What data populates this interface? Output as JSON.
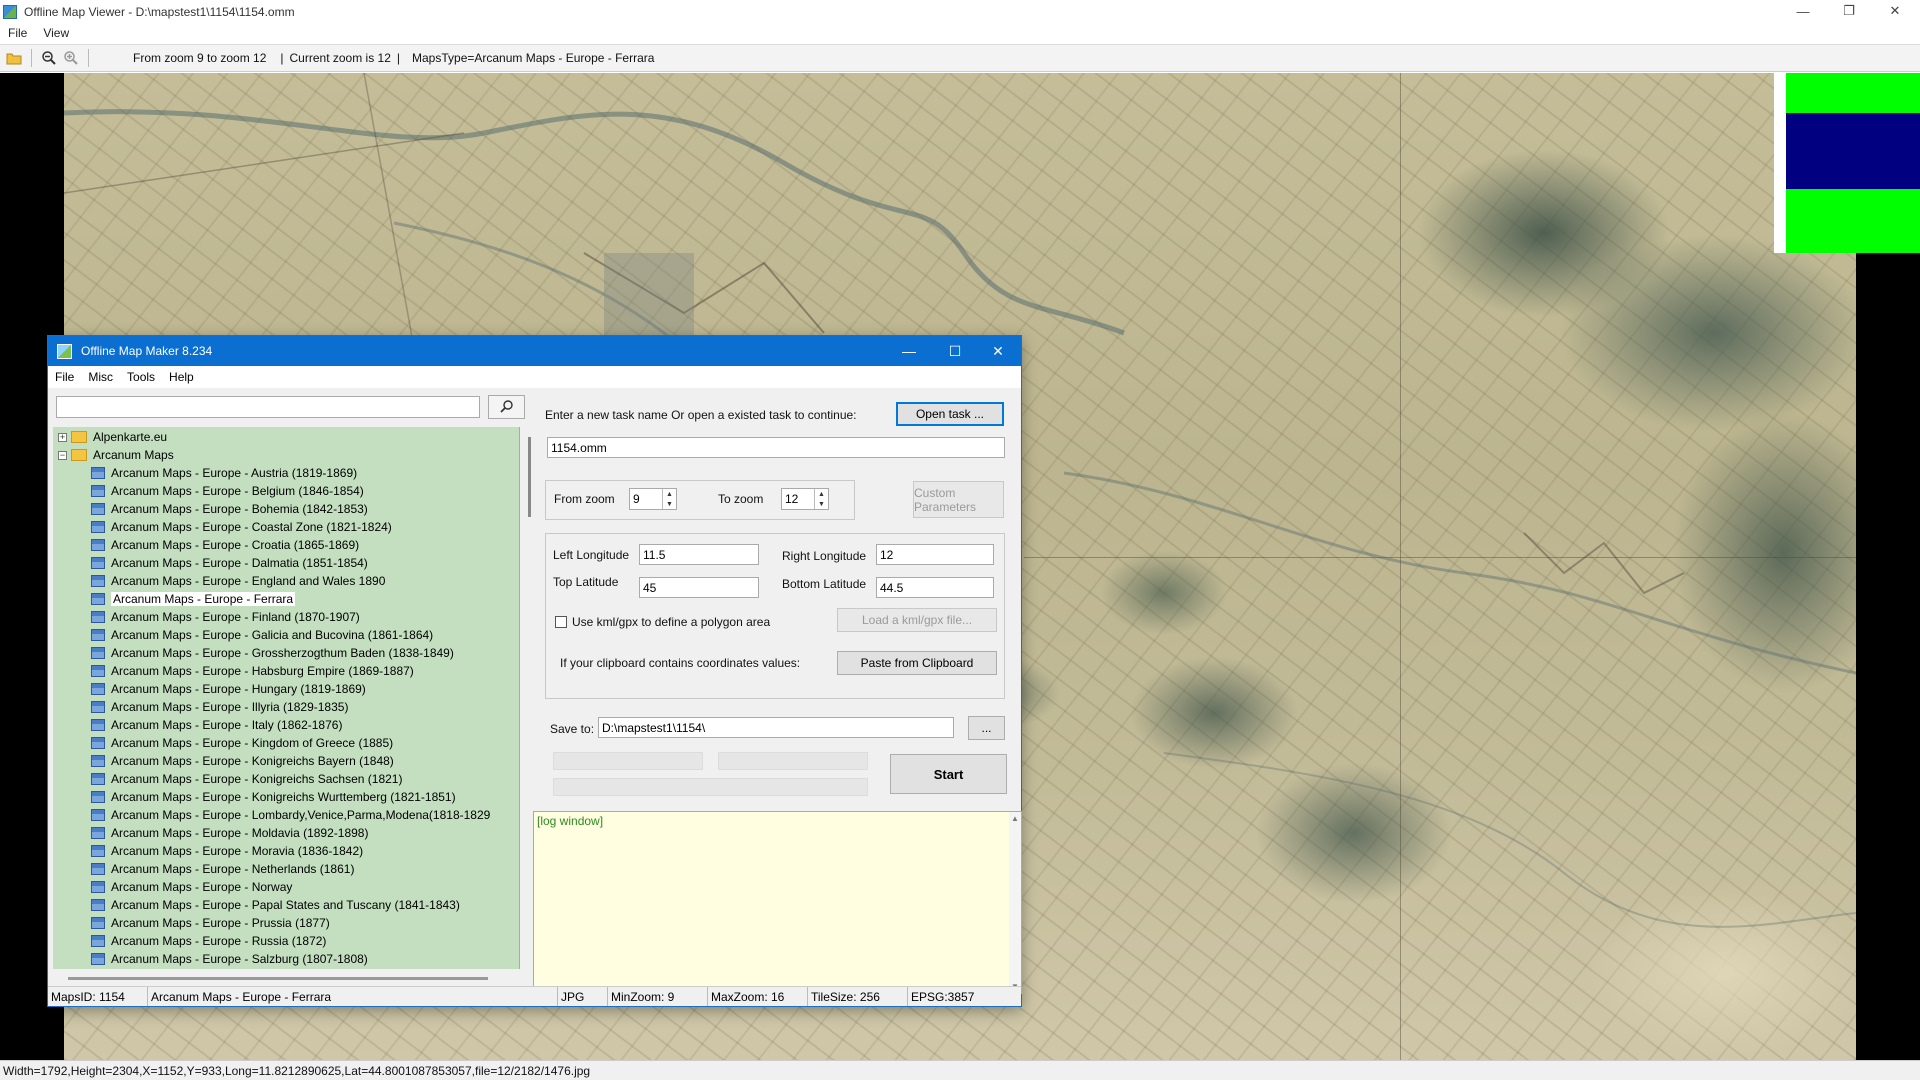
{
  "window": {
    "title": "Offline Map Viewer - D:\\mapstest1\\1154\\1154.omm"
  },
  "menu": [
    "File",
    "View"
  ],
  "toolbar": {
    "zoom_range": "From zoom 9 to zoom 12",
    "current_zoom": "Current zoom is 12",
    "maps_type": "MapsType=Arcanum Maps - Europe - Ferrara",
    "icons": [
      "open-folder-icon",
      "zoom-out-icon",
      "zoom-in-icon"
    ]
  },
  "colors": {
    "legend_top": "#00ff00",
    "legend_middle": "#000080",
    "legend_bottom": "#00ff00",
    "dialog_title": "#0a6fd1",
    "tree_bg": "#c3dfc0",
    "log_bg": "#fffee0"
  },
  "statusbar": {
    "text": "Width=1792,Height=2304,X=1152,Y=933,Long=11.8212890625,Lat=44.8001087853057,file=12/2182/1476.jpg"
  },
  "dialog": {
    "title": "Offline Map Maker 8.234",
    "menu": [
      "File",
      "Misc",
      "Tools",
      "Help"
    ],
    "search": {
      "value": "",
      "placeholder": ""
    },
    "tree": {
      "folders": [
        {
          "label": "Alpenkarte.eu",
          "expanded": false
        },
        {
          "label": "Arcanum Maps",
          "expanded": true
        }
      ],
      "items": [
        "Arcanum Maps - Europe - Austria (1819-1869)",
        "Arcanum Maps - Europe - Belgium (1846-1854)",
        "Arcanum Maps - Europe - Bohemia (1842-1853)",
        "Arcanum Maps - Europe - Coastal Zone (1821-1824)",
        "Arcanum Maps - Europe - Croatia (1865-1869)",
        "Arcanum Maps - Europe - Dalmatia (1851-1854)",
        "Arcanum Maps - Europe - England and Wales 1890",
        "Arcanum Maps - Europe - Ferrara",
        "Arcanum Maps - Europe - Finland (1870-1907)",
        "Arcanum Maps - Europe - Galicia and Bucovina (1861-1864)",
        "Arcanum Maps - Europe - Grossherzogthum Baden (1838-1849)",
        "Arcanum Maps - Europe - Habsburg Empire (1869-1887)",
        "Arcanum Maps - Europe - Hungary (1819-1869)",
        "Arcanum Maps - Europe - Illyria (1829-1835)",
        "Arcanum Maps - Europe - Italy (1862-1876)",
        "Arcanum Maps - Europe - Kingdom of Greece (1885)",
        "Arcanum Maps - Europe - Konigreichs Bayern (1848)",
        "Arcanum Maps - Europe - Konigreichs Sachsen (1821)",
        "Arcanum Maps - Europe - Konigreichs Wurttemberg (1821-1851)",
        "Arcanum Maps - Europe - Lombardy,Venice,Parma,Modena(1818-1829",
        "Arcanum Maps - Europe - Moldavia (1892-1898)",
        "Arcanum Maps - Europe - Moravia (1836-1842)",
        "Arcanum Maps - Europe - Netherlands (1861)",
        "Arcanum Maps - Europe - Norway",
        "Arcanum Maps - Europe - Papal States and Tuscany (1841-1843)",
        "Arcanum Maps - Europe - Prussia (1877)",
        "Arcanum Maps - Europe - Russia (1872)",
        "Arcanum Maps - Europe - Salzburg (1807-1808)"
      ],
      "selected": "Arcanum Maps - Europe - Ferrara"
    },
    "task_prompt": "Enter a new task name Or open a existed task to continue:",
    "open_task_label": "Open task ...",
    "task_name": "1154.omm",
    "from_zoom_label": "From zoom",
    "from_zoom_value": "9",
    "to_zoom_label": "To zoom",
    "to_zoom_value": "12",
    "custom_params_label": "Custom Parameters",
    "left_lon_label": "Left Longitude",
    "left_lon_value": "11.5",
    "right_lon_label": "Right Longitude",
    "right_lon_value": "12",
    "top_lat_label": "Top Latitude",
    "top_lat_value": "45",
    "bottom_lat_label": "Bottom Latitude",
    "bottom_lat_value": "44.5",
    "kml_checkbox_label": "Use kml/gpx to define a polygon area",
    "kml_checked": false,
    "load_kml_label": "Load a kml/gpx file...",
    "clipboard_prompt": "If your clipboard contains coordinates values:",
    "paste_label": "Paste from Clipboard",
    "save_to_label": "Save to:",
    "save_to_value": "D:\\mapstest1\\1154\\",
    "browse_label": "...",
    "start_label": "Start",
    "log_text": "[log window]",
    "status": {
      "maps_id": "MapsID: 1154",
      "map_name": "Arcanum Maps - Europe - Ferrara",
      "format": "JPG",
      "min_zoom": "MinZoom: 9",
      "max_zoom": "MaxZoom: 16",
      "tile_size": "TileSize: 256",
      "epsg": "EPSG:3857"
    }
  }
}
